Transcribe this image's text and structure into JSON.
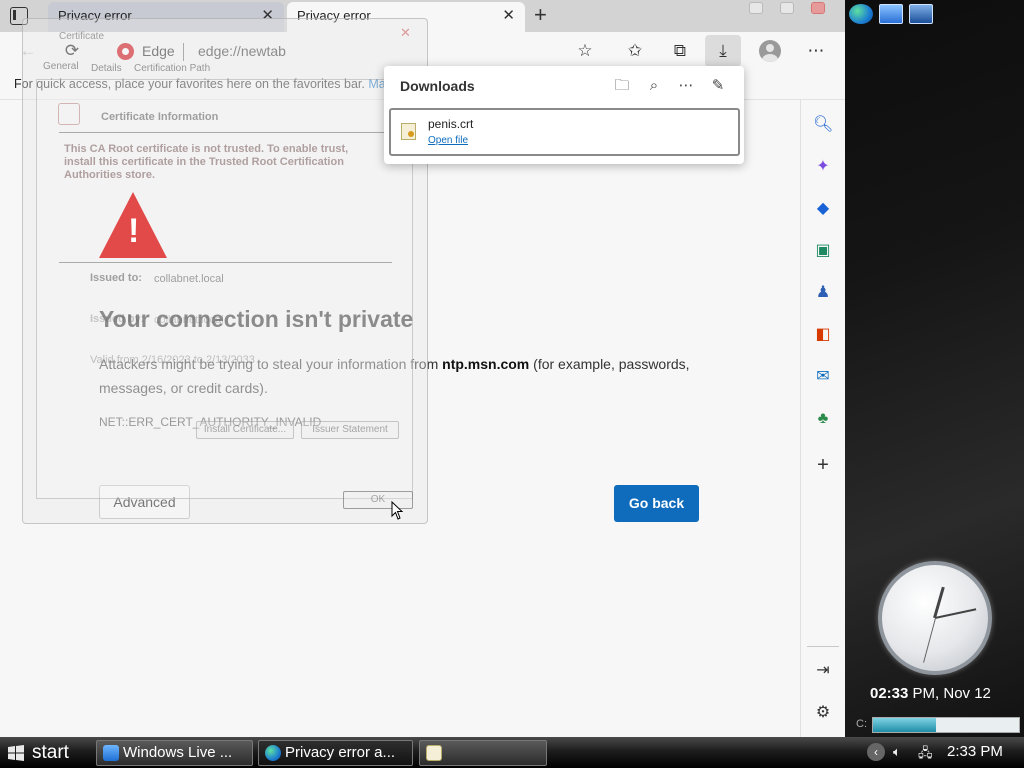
{
  "browser": {
    "tabs": [
      {
        "label": "Privacy error"
      },
      {
        "label": "Privacy error"
      }
    ],
    "omnibox": {
      "site_label": "Edge",
      "url": "edge://newtab"
    },
    "favorites_bar": {
      "text": "For quick access, place your favorites here on the favorites bar.",
      "manage_link": "Mar"
    }
  },
  "downloads": {
    "title": "Downloads",
    "item": {
      "filename": "penis.crt",
      "action": "Open file"
    }
  },
  "error_page": {
    "title": "Your connection isn't private",
    "desc_prefix": "Attackers might be trying to steal your information from ",
    "host": "ntp.msn.com",
    "desc_suffix": " (for example, passwords, messages, or credit cards).",
    "error_code": "NET::ERR_CERT_AUTHORITY_INVALID",
    "advanced_label": "Advanced",
    "go_back_label": "Go back"
  },
  "certificate_dialog": {
    "title": "Certificate",
    "tabs": [
      "General",
      "Details",
      "Certification Path"
    ],
    "heading": "Certificate Information",
    "warning": "This CA Root certificate is not trusted. To enable trust, install this certificate in the Trusted Root Certification Authorities store.",
    "issued_to_label": "Issued to:",
    "issued_to_value": "collabnet.local",
    "issued_by_label": "Issued by:",
    "issued_by_value": "collabnet.local",
    "valid_from": "Valid from 2/16/2023 to 2/13/2033",
    "install_button": "Install Certificate...",
    "issuer_button": "Issuer Statement",
    "ok_button": "OK"
  },
  "desktop": {
    "clock_time": "02:33",
    "clock_suffix": " PM, Nov 12",
    "drive_label": "C:",
    "drive_usage": 0.43
  },
  "taskbar": {
    "start_label": "start",
    "tasks": [
      {
        "label": "Windows Live ..."
      },
      {
        "label": "Privacy error a..."
      },
      {
        "label": ""
      }
    ],
    "tray_time": "2:33 PM"
  },
  "colors": {
    "accent": "#0f6cbd",
    "warning_red": "#e24a4a",
    "edge_red": "#d6262d"
  }
}
